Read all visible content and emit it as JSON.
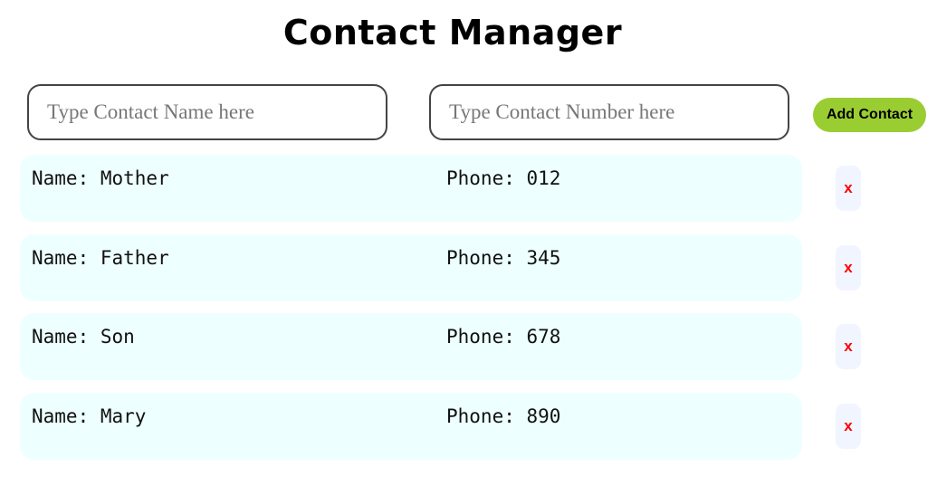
{
  "app": {
    "title": "Contact Manager"
  },
  "form": {
    "name_placeholder": "Type Contact Name here",
    "number_placeholder": "Type Contact Number here",
    "add_label": "Add Contact"
  },
  "contacts": [
    {
      "name": "Name: Mother",
      "phone": "Phone: 012",
      "delete_label": "x"
    },
    {
      "name": "Name: Father",
      "phone": "Phone: 345",
      "delete_label": "x"
    },
    {
      "name": "Name: Son",
      "phone": "Phone: 678",
      "delete_label": "x"
    },
    {
      "name": "Name: Mary",
      "phone": "Phone: 890",
      "delete_label": "x"
    }
  ],
  "colors": {
    "add_button": "#9acd32",
    "row_background": "#eeffff",
    "delete_text": "#ff0000",
    "delete_background": "#f1f5ff"
  }
}
